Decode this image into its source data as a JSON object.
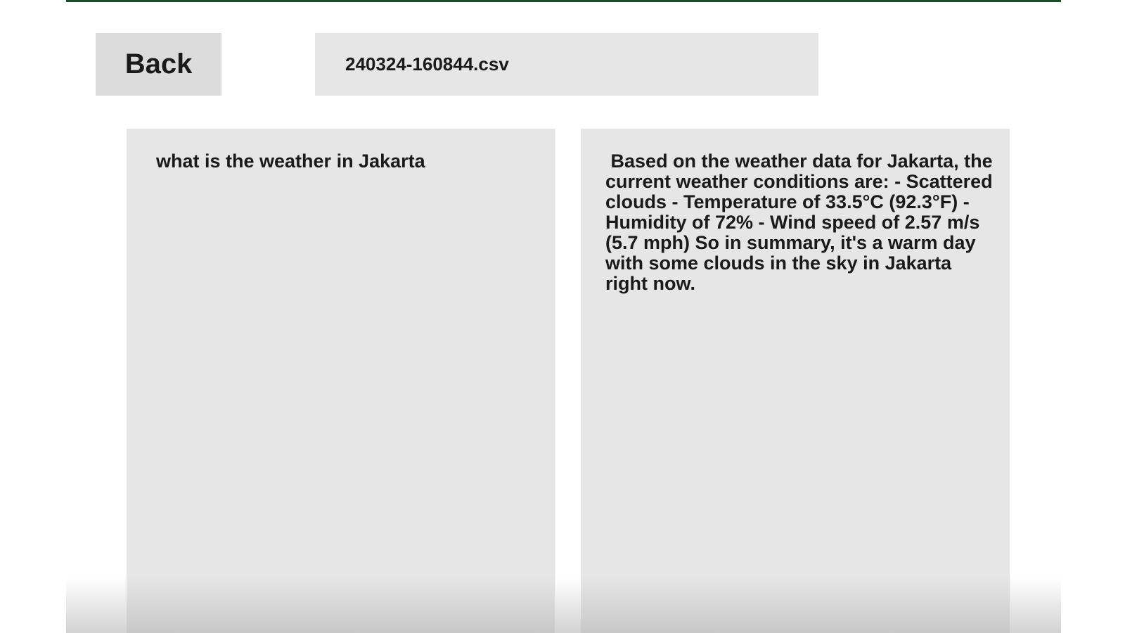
{
  "toolbar": {
    "back_label": "Back",
    "filename": "240324-160844.csv"
  },
  "chat": {
    "question": "what is the weather in Jakarta",
    "answer": " Based on the weather data for Jakarta, the current weather conditions are: - Scattered clouds - Temperature of 33.5°C (92.3°F) - Humidity of 72% - Wind speed of 2.57 m/s (5.7 mph) So in summary, it's a warm day with some clouds in the sky in Jakarta right now."
  },
  "colors": {
    "accent_top_border": "#1f4d2c",
    "panel_background": "#e6e6e6",
    "button_background": "#dcdcdc"
  }
}
